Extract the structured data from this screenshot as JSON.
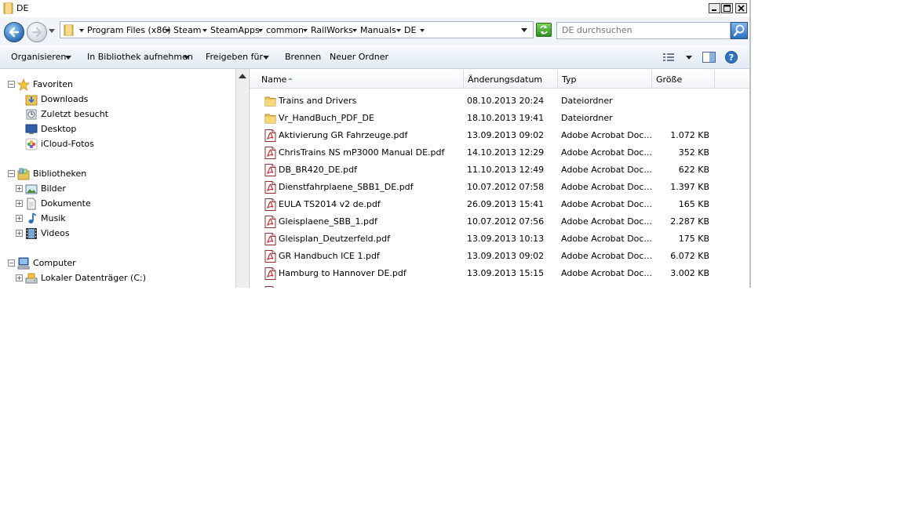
{
  "window": {
    "title": "DE"
  },
  "address": {
    "crumbs": [
      "Program Files (x86)",
      "Steam",
      "SteamApps",
      "common",
      "RailWorks",
      "Manuals",
      "DE"
    ],
    "search_placeholder": "DE durchsuchen"
  },
  "toolbar": {
    "organize": "Organisieren",
    "include_library": "In Bibliothek aufnehmen",
    "share": "Freigeben für",
    "burn": "Brennen",
    "new_folder": "Neuer Ordner"
  },
  "nav": {
    "favorites": {
      "label": "Favoriten",
      "items": [
        "Downloads",
        "Zuletzt besucht",
        "Desktop",
        "iCloud-Fotos"
      ]
    },
    "libraries": {
      "label": "Bibliotheken",
      "items": [
        "Bilder",
        "Dokumente",
        "Musik",
        "Videos"
      ]
    },
    "computer": {
      "label": "Computer",
      "items": [
        "Lokaler Datenträger (C:)"
      ]
    }
  },
  "columns": {
    "name": "Name",
    "date": "Änderungsdatum",
    "type": "Typ",
    "size": "Größe"
  },
  "files": [
    {
      "name": "Trains and Drivers",
      "date": "08.10.2013 20:24",
      "type": "Dateiordner",
      "size": "",
      "kind": "folder"
    },
    {
      "name": "Vr_HandBuch_PDF_DE",
      "date": "18.10.2013 19:41",
      "type": "Dateiordner",
      "size": "",
      "kind": "folder"
    },
    {
      "name": "Aktivierung GR Fahrzeuge.pdf",
      "date": "13.09.2013 09:02",
      "type": "Adobe Acrobat Doc...",
      "size": "1.072 KB",
      "kind": "pdf"
    },
    {
      "name": "ChrisTrains NS mP3000 Manual DE.pdf",
      "date": "14.10.2013 12:29",
      "type": "Adobe Acrobat Doc...",
      "size": "352 KB",
      "kind": "pdf"
    },
    {
      "name": "DB_BR420_DE.pdf",
      "date": "11.10.2013 12:49",
      "type": "Adobe Acrobat Doc...",
      "size": "622 KB",
      "kind": "pdf"
    },
    {
      "name": "Dienstfahrplaene_SBB1_DE.pdf",
      "date": "10.07.2012 07:58",
      "type": "Adobe Acrobat Doc...",
      "size": "1.397 KB",
      "kind": "pdf"
    },
    {
      "name": "EULA TS2014 v2 de.pdf",
      "date": "26.09.2013 15:41",
      "type": "Adobe Acrobat Doc...",
      "size": "165 KB",
      "kind": "pdf"
    },
    {
      "name": "Gleisplaene_SBB_1.pdf",
      "date": "10.07.2012 07:56",
      "type": "Adobe Acrobat Doc...",
      "size": "2.287 KB",
      "kind": "pdf"
    },
    {
      "name": "Gleisplan_Deutzerfeld.pdf",
      "date": "13.09.2013 10:13",
      "type": "Adobe Acrobat Doc...",
      "size": "175 KB",
      "kind": "pdf"
    },
    {
      "name": "GR Handbuch ICE 1.pdf",
      "date": "13.09.2013 09:02",
      "type": "Adobe Acrobat Doc...",
      "size": "6.072 KB",
      "kind": "pdf"
    },
    {
      "name": "Hamburg to Hannover DE.pdf",
      "date": "13.09.2013 15:15",
      "type": "Adobe Acrobat Doc...",
      "size": "3.002 KB",
      "kind": "pdf"
    }
  ]
}
